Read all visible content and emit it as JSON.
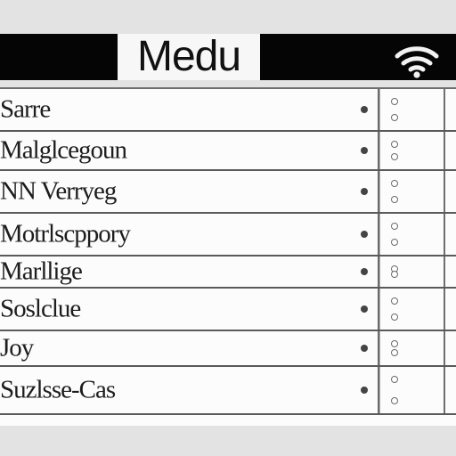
{
  "header": {
    "title": "Medu",
    "status_icon": "wifi-icon"
  },
  "menu": {
    "items": [
      {
        "label": "Sarre",
        "control_icon": "dot-icon"
      },
      {
        "label": "Malglcegoun",
        "control_icon": "dot-icon"
      },
      {
        "label": "NN Verryeg",
        "control_icon": "dot-icon"
      },
      {
        "label": "Motrlscppory",
        "control_icon": "dot-icon"
      },
      {
        "label": "Marllige",
        "control_icon": "dot-icon"
      },
      {
        "label": "Soslclue",
        "control_icon": "dot-icon"
      },
      {
        "label": "Joy",
        "control_icon": "dot-icon"
      },
      {
        "label": "Suzlsse-Cas",
        "control_icon": "dot-icon"
      }
    ]
  },
  "colors": {
    "header_bg": "#050505",
    "title_bg": "#f7f7f7",
    "page_bg": "#e3e3e3",
    "row_bg": "#fcfcfc",
    "divider": "#5a5a5a"
  }
}
